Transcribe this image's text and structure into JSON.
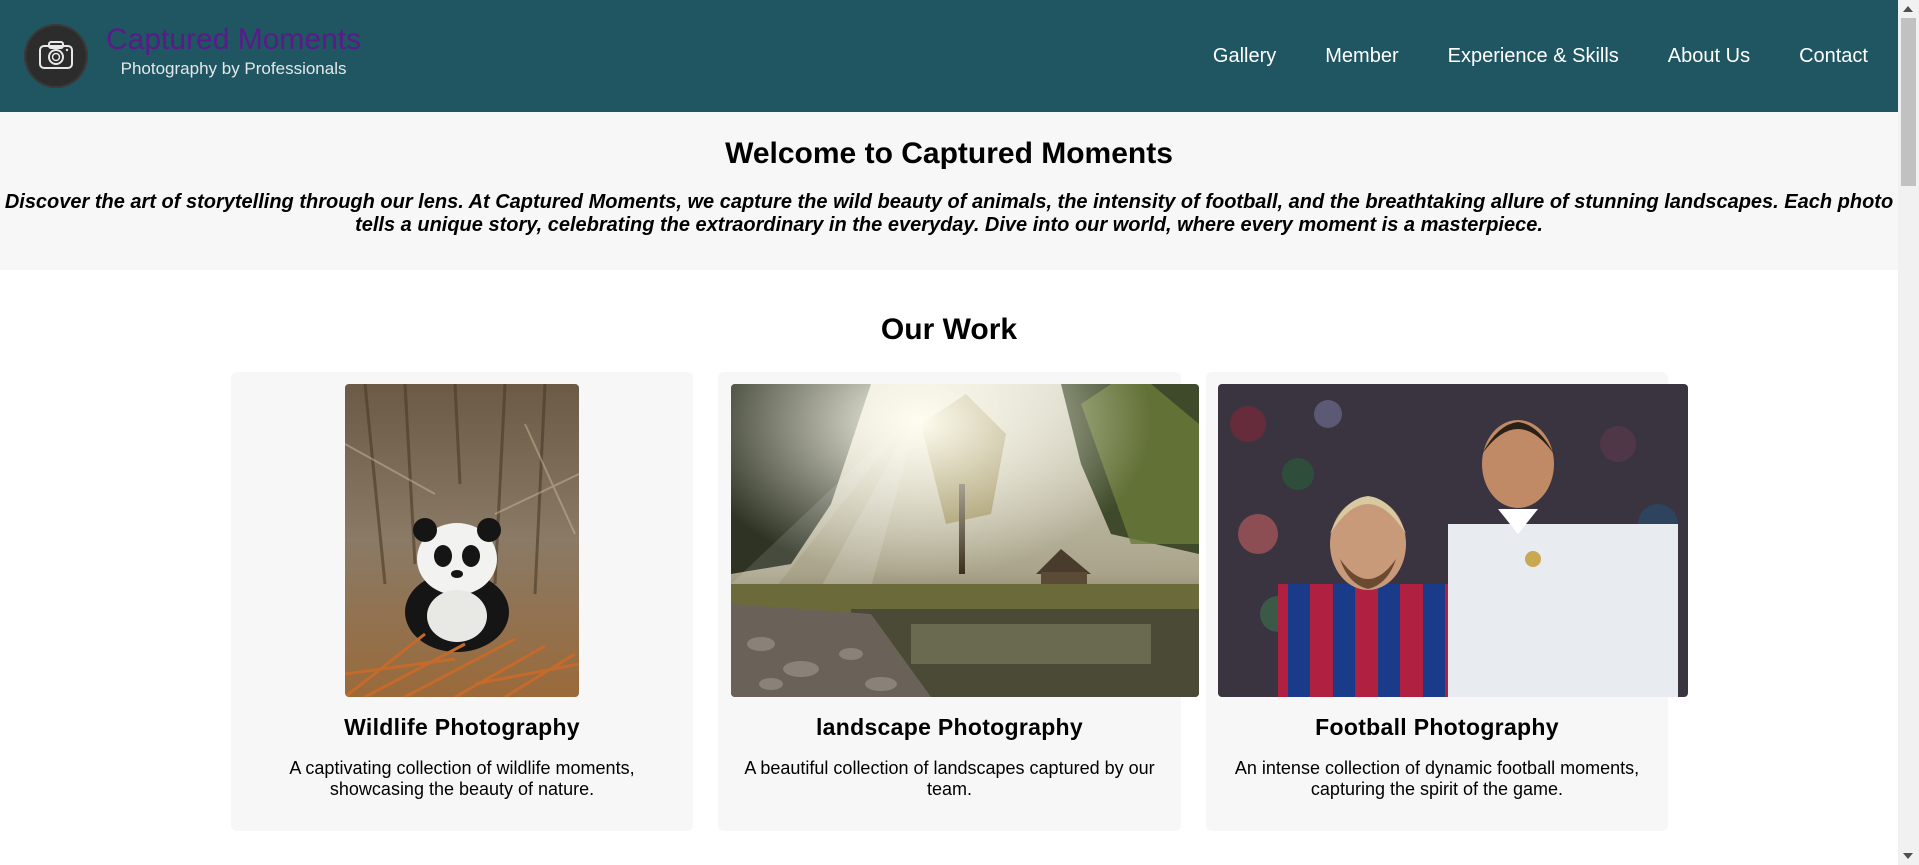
{
  "header": {
    "brand_title": "Captured Moments",
    "brand_subtitle": "Photography by Professionals",
    "logo_icon": "camera-icon",
    "nav": [
      {
        "label": "Gallery"
      },
      {
        "label": "Member"
      },
      {
        "label": "Experience & Skills"
      },
      {
        "label": "About Us"
      },
      {
        "label": "Contact"
      }
    ]
  },
  "welcome": {
    "title": "Welcome to Captured Moments",
    "text": "Discover the art of storytelling through our lens. At Captured Moments, we capture the wild beauty of animals, the intensity of football, and the breathtaking allure of stunning landscapes. Each photo tells a unique story, celebrating the extraordinary in the everyday. Dive into our world, where every moment is a masterpiece."
  },
  "work": {
    "heading": "Our Work",
    "cards": [
      {
        "title": "Wildlife Photography",
        "description": "A captivating collection of wildlife moments, showcasing the beauty of nature.",
        "image": "panda-photo"
      },
      {
        "title": "landscape Photography",
        "description": "A beautiful collection of landscapes captured by our team.",
        "image": "forest-river-photo"
      },
      {
        "title": "Football Photography",
        "description": "An intense collection of dynamic football moments, capturing the spirit of the game.",
        "image": "football-players-photo"
      }
    ]
  },
  "colors": {
    "header_bg": "#1f5661",
    "brand_title": "#5a1a8a",
    "section_bg": "#f7f7f7"
  }
}
